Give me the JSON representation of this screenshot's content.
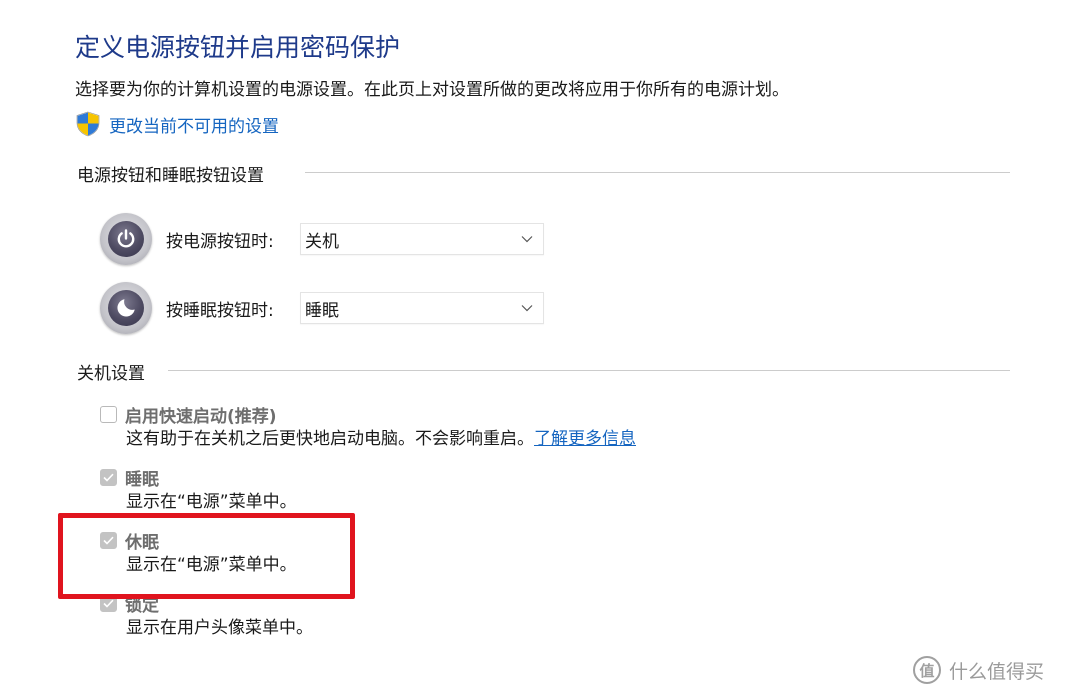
{
  "page": {
    "title": "定义电源按钮并启用密码保护",
    "description": "选择要为你的计算机设置的电源设置。在此页上对设置所做的更改将应用于你所有的电源计划。",
    "change_link": "更改当前不可用的设置"
  },
  "power_buttons": {
    "heading": "电源按钮和睡眠按钮设置",
    "power_label": "按电源按钮时:",
    "power_value": "关机",
    "sleep_label": "按睡眠按钮时:",
    "sleep_value": "睡眠"
  },
  "shutdown": {
    "heading": "关机设置",
    "options": [
      {
        "title": "启用快速启动(推荐)",
        "desc": "这有助于在关机之后更快地启动电脑。不会影响重启。",
        "link": "了解更多信息",
        "checked": false
      },
      {
        "title": "睡眠",
        "desc": "显示在“电源”菜单中。",
        "checked": true
      },
      {
        "title": "休眠",
        "desc": "显示在“电源”菜单中。",
        "checked": true
      },
      {
        "title": "锁定",
        "desc": "显示在用户头像菜单中。",
        "checked": true
      }
    ]
  },
  "watermark": {
    "logo_text": "值",
    "text": "什么值得买"
  },
  "colors": {
    "title": "#1e3a8a",
    "link": "#1565c0",
    "highlight": "#e0141e",
    "disabled_text": "#6e6e6e"
  }
}
